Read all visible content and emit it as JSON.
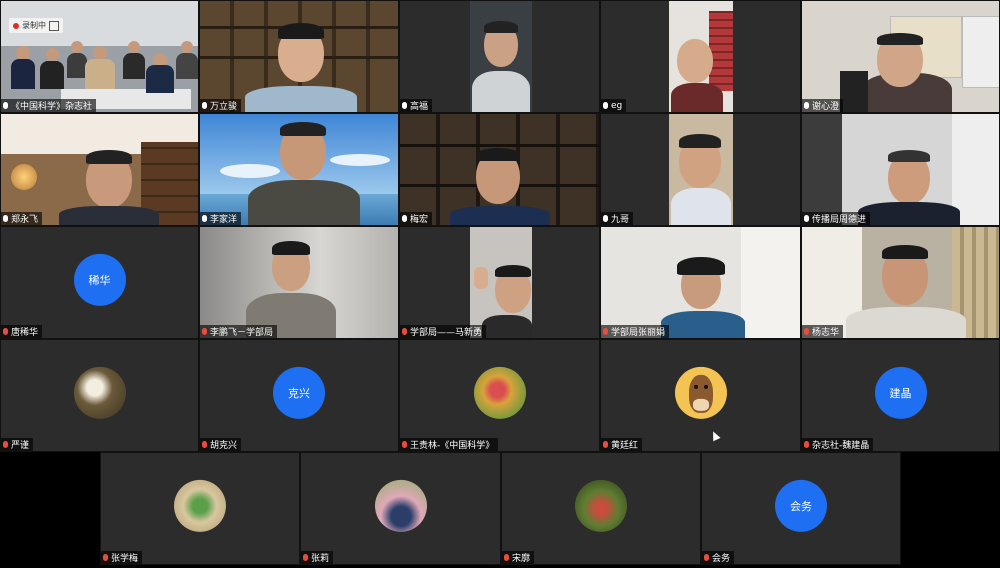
{
  "recording": {
    "label": "录制中"
  },
  "participants": [
    {
      "name": "《中国科学》杂志社",
      "muted": false
    },
    {
      "name": "万立骏",
      "muted": false
    },
    {
      "name": "高福",
      "muted": false
    },
    {
      "name": "eg",
      "muted": false
    },
    {
      "name": "谢心澄",
      "muted": false
    },
    {
      "name": "郑永飞",
      "muted": false
    },
    {
      "name": "李家洋",
      "muted": false
    },
    {
      "name": "梅宏",
      "muted": false
    },
    {
      "name": "九哥",
      "muted": false
    },
    {
      "name": "传播局周德进",
      "muted": false
    },
    {
      "name": "唐稀华",
      "muted": true,
      "avatar_text": "稀华",
      "avatar_color": "#1e6ff2"
    },
    {
      "name": "李鹏飞－学部局",
      "muted": true
    },
    {
      "name": "学部局——马新勇",
      "muted": true
    },
    {
      "name": "学部局张丽娟",
      "muted": true
    },
    {
      "name": "杨志华",
      "muted": true
    },
    {
      "name": "严谨",
      "muted": true,
      "avatar_icon": "magnolia-photo"
    },
    {
      "name": "胡克兴",
      "muted": true,
      "avatar_text": "克兴",
      "avatar_color": "#1e6ff2"
    },
    {
      "name": "王贵林-《中国科学》",
      "muted": true,
      "avatar_icon": "flowers-photo"
    },
    {
      "name": "黄廷红",
      "muted": true,
      "avatar_icon": "horse-cartoon"
    },
    {
      "name": "杂志社-魏建晶",
      "muted": true,
      "avatar_text": "建晶",
      "avatar_color": "#1e6ff2"
    },
    {
      "name": "张学梅",
      "muted": true,
      "avatar_icon": "clover-photo"
    },
    {
      "name": "张莉",
      "muted": true,
      "avatar_icon": "person-blossom-photo"
    },
    {
      "name": "宋廓",
      "muted": true,
      "avatar_icon": "garden-photo"
    },
    {
      "name": "会务",
      "muted": true,
      "avatar_text": "会务",
      "avatar_color": "#1e6ff2"
    }
  ]
}
